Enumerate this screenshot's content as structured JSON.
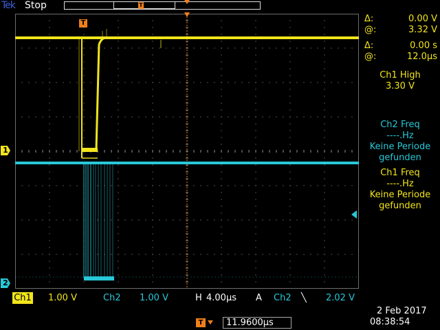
{
  "header": {
    "brand": "Tek",
    "status": "Stop"
  },
  "trigger_marker": "T",
  "channels": {
    "ch1_marker": "1",
    "ch2_marker": "2"
  },
  "cursors": {
    "delta_v_symbol": "Δ:",
    "delta_v": "0.00 V",
    "at_v_symbol": "@:",
    "at_v": "3.32 V",
    "delta_t_symbol": "Δ:",
    "delta_t": "0.00 s",
    "at_t_symbol": "@:",
    "at_t": "12.0µs"
  },
  "measurements": {
    "ch1_high_label": "Ch1 High",
    "ch1_high_value": "3.30 V",
    "ch2_freq_label": "Ch2 Freq",
    "ch2_freq_value": "----.Hz",
    "ch2_note_1": "Keine Periode",
    "ch2_note_2": "gefunden",
    "ch1_freq_label": "Ch1 Freq",
    "ch1_freq_value": "----.Hz",
    "ch1_note_1": "Keine Periode",
    "ch1_note_2": "gefunden"
  },
  "bottom": {
    "ch1_label": "Ch1",
    "ch1_scale": "1.00 V",
    "ch2_label": "Ch2",
    "ch2_scale": "1.00 V",
    "h_label": "H",
    "h_scale": "4.00µs",
    "trig_src_label": "A",
    "trig_ch": "Ch2",
    "trig_slope": "╲",
    "trig_level": "2.02 V",
    "trig_pos": "11.9600µs",
    "date": "2 Feb  2017",
    "time": "08:38:54"
  },
  "colors": {
    "ch1": "#f2e51c",
    "ch2": "#28c8d8",
    "trigger": "#f07f1a",
    "grid": "#6e6e6e"
  }
}
